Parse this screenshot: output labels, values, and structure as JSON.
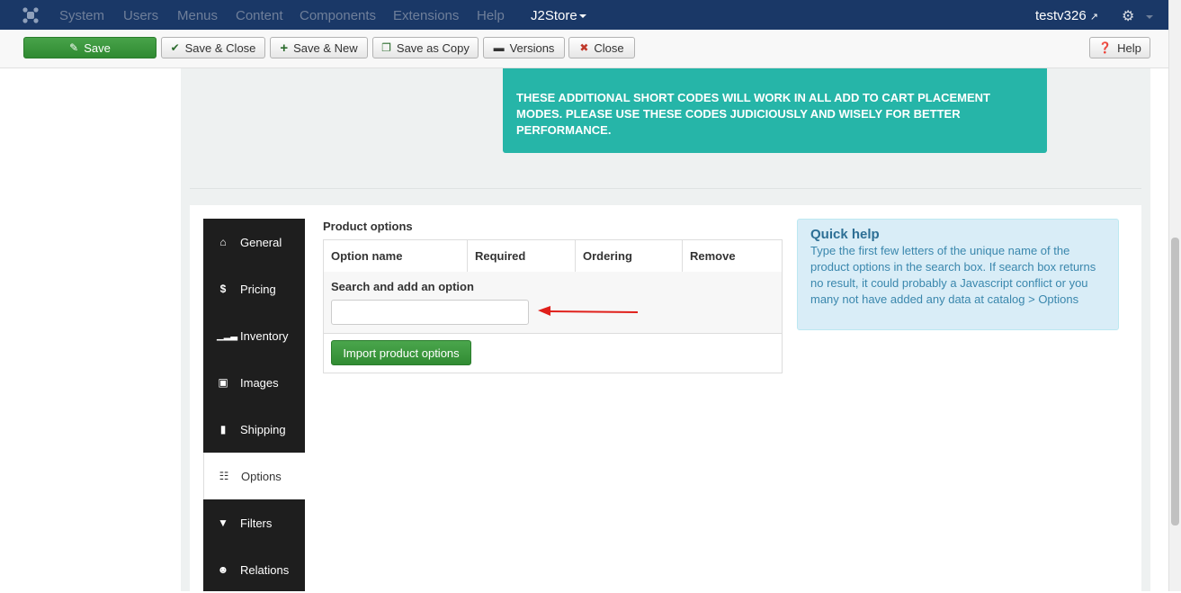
{
  "navbar": {
    "menu": [
      "System",
      "Users",
      "Menus",
      "Content",
      "Components",
      "Extensions",
      "Help"
    ],
    "j2store": "J2Store",
    "user": "testv326"
  },
  "toolbar": {
    "save": "Save",
    "save_close": "Save & Close",
    "save_new": "Save & New",
    "save_copy": "Save as Copy",
    "versions": "Versions",
    "close": "Close",
    "help": "Help"
  },
  "notice": "THESE ADDITIONAL SHORT CODES WILL WORK IN ALL ADD TO CART PLACEMENT MODES. PLEASE USE THESE CODES JUDICIOUSLY AND WISELY FOR BETTER PERFORMANCE.",
  "tabs": [
    {
      "label": "General",
      "icon": "home-icon"
    },
    {
      "label": "Pricing",
      "icon": "dollar-icon"
    },
    {
      "label": "Inventory",
      "icon": "signal-icon"
    },
    {
      "label": "Images",
      "icon": "image-icon"
    },
    {
      "label": "Shipping",
      "icon": "truck-icon"
    },
    {
      "label": "Options",
      "icon": "sitemap-icon",
      "active": true
    },
    {
      "label": "Filters",
      "icon": "filter-icon"
    },
    {
      "label": "Relations",
      "icon": "users-icon"
    }
  ],
  "product_options": {
    "title": "Product options",
    "columns": [
      "Option name",
      "Required",
      "Ordering",
      "Remove"
    ],
    "search_label": "Search and add an option",
    "search_value": "",
    "import_button": "Import product options"
  },
  "quick_help": {
    "title": "Quick help",
    "text": "Type the first few letters of the unique name of the product options in the search box. If search box returns no result, it could probably a Javascript conflict or you many not have added any data at catalog > Options"
  },
  "colors": {
    "navbar": "#1a3867",
    "save_green": "#2f8a31",
    "notice_teal": "#26b5a8",
    "tab_dark": "#1e1e1e",
    "quick_help_bg": "#d9edf7",
    "arrow_red": "#e0201b"
  }
}
